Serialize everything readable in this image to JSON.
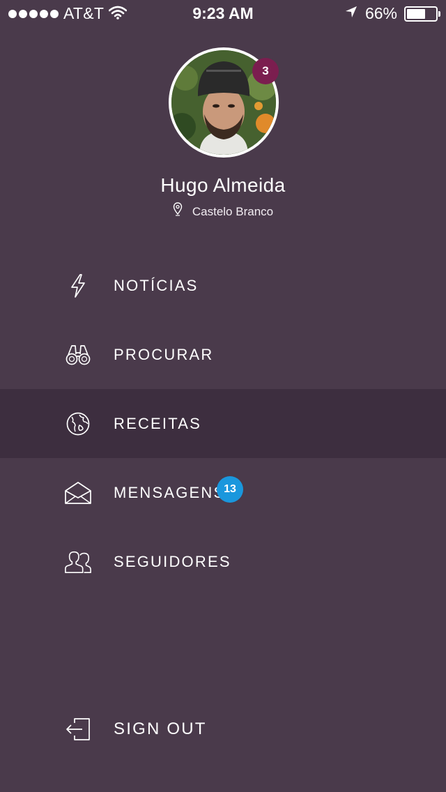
{
  "status_bar": {
    "carrier": "AT&T",
    "time": "9:23 AM",
    "battery_percent": "66%",
    "battery_level": 0.66,
    "signal_bars": 5
  },
  "profile": {
    "name": "Hugo Almeida",
    "location": "Castelo Branco",
    "notification_count": "3"
  },
  "menu": {
    "items": [
      {
        "label": "NOTÍCIAS",
        "icon": "lightning-icon"
      },
      {
        "label": "PROCURAR",
        "icon": "binoculars-icon"
      },
      {
        "label": "RECEITAS",
        "icon": "globe-icon",
        "active": true
      },
      {
        "label": "MENSAGENS",
        "icon": "envelope-icon",
        "badge": "13"
      },
      {
        "label": "SEGUIDORES",
        "icon": "followers-icon"
      }
    ],
    "sign_out": {
      "label": "SIGN OUT",
      "icon": "sign-out-icon"
    }
  },
  "colors": {
    "background": "#4a3a4b",
    "active_row": "#3d2e3f",
    "notification_badge": "#7b1e4f",
    "message_badge": "#1a97dd"
  }
}
